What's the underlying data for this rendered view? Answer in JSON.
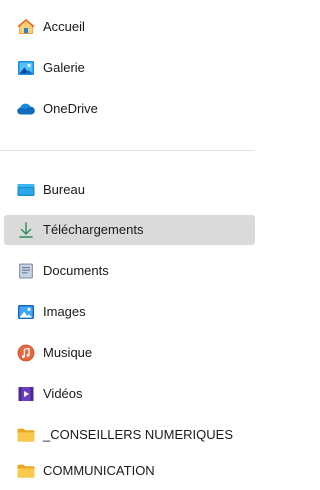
{
  "sidebar": {
    "quick_access": [
      {
        "label": "Accueil",
        "icon": "home-icon"
      },
      {
        "label": "Galerie",
        "icon": "gallery-icon"
      },
      {
        "label": "OneDrive",
        "icon": "onedrive-cloud-icon"
      }
    ],
    "folders": [
      {
        "label": "Bureau",
        "icon": "desktop-folder-icon"
      },
      {
        "label": "Téléchargements",
        "icon": "download-arrow-icon",
        "selected": true
      },
      {
        "label": "Documents",
        "icon": "documents-icon"
      },
      {
        "label": "Images",
        "icon": "pictures-icon"
      },
      {
        "label": "Musique",
        "icon": "music-icon"
      },
      {
        "label": "Vidéos",
        "icon": "videos-icon"
      },
      {
        "label": "_CONSEILLERS NUMERIQUES",
        "icon": "folder-icon"
      },
      {
        "label": "COMMUNICATION",
        "icon": "folder-icon"
      }
    ]
  },
  "colors": {
    "selected_background": "#dadada",
    "divider": "#e4e4e4",
    "folder_yellow": "#f5c04a",
    "accent_blue": "#0f6cbd",
    "download_green": "#2e8b57"
  }
}
